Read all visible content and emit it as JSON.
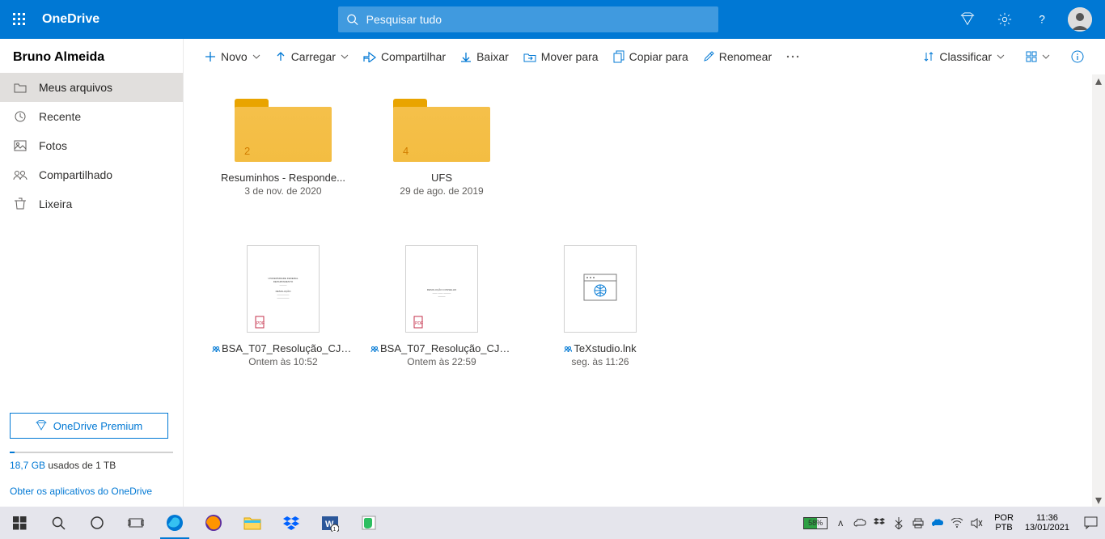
{
  "header": {
    "app_name": "OneDrive",
    "search_placeholder": "Pesquisar tudo"
  },
  "sidebar": {
    "user": "Bruno Almeida",
    "items": [
      {
        "label": "Meus arquivos"
      },
      {
        "label": "Recente"
      },
      {
        "label": "Fotos"
      },
      {
        "label": "Compartilhado"
      },
      {
        "label": "Lixeira"
      }
    ],
    "premium_label": "OneDrive Premium",
    "storage_used": "18,7 GB",
    "storage_total": " usados de 1 TB",
    "apps_link": "Obter os aplicativos do OneDrive"
  },
  "cmdbar": {
    "novo": "Novo",
    "carregar": "Carregar",
    "compartilhar": "Compartilhar",
    "baixar": "Baixar",
    "mover": "Mover para",
    "copiar": "Copiar para",
    "renomear": "Renomear",
    "classificar": "Classificar"
  },
  "files": [
    {
      "type": "folder",
      "badge": "2",
      "name": "Resuminhos - Responde...",
      "date": "3 de nov. de 2020"
    },
    {
      "type": "folder",
      "badge": "4",
      "name": "UFS",
      "date": "29 de ago. de 2019"
    },
    {
      "type": "pdf",
      "name": "BSA_T07_Resolução_CJ_...",
      "date": "Ontem às 10:52",
      "shared": true
    },
    {
      "type": "pdf",
      "name": "BSA_T07_Resolução_CJ_...",
      "date": "Ontem às 22:59",
      "shared": true
    },
    {
      "type": "link",
      "name": "TeXstudio.lnk",
      "date": "seg. às 11:26",
      "shared": true
    }
  ],
  "taskbar": {
    "battery_pct": "58%",
    "lang1": "POR",
    "lang2": "PTB",
    "time": "11:36",
    "date": "13/01/2021"
  }
}
